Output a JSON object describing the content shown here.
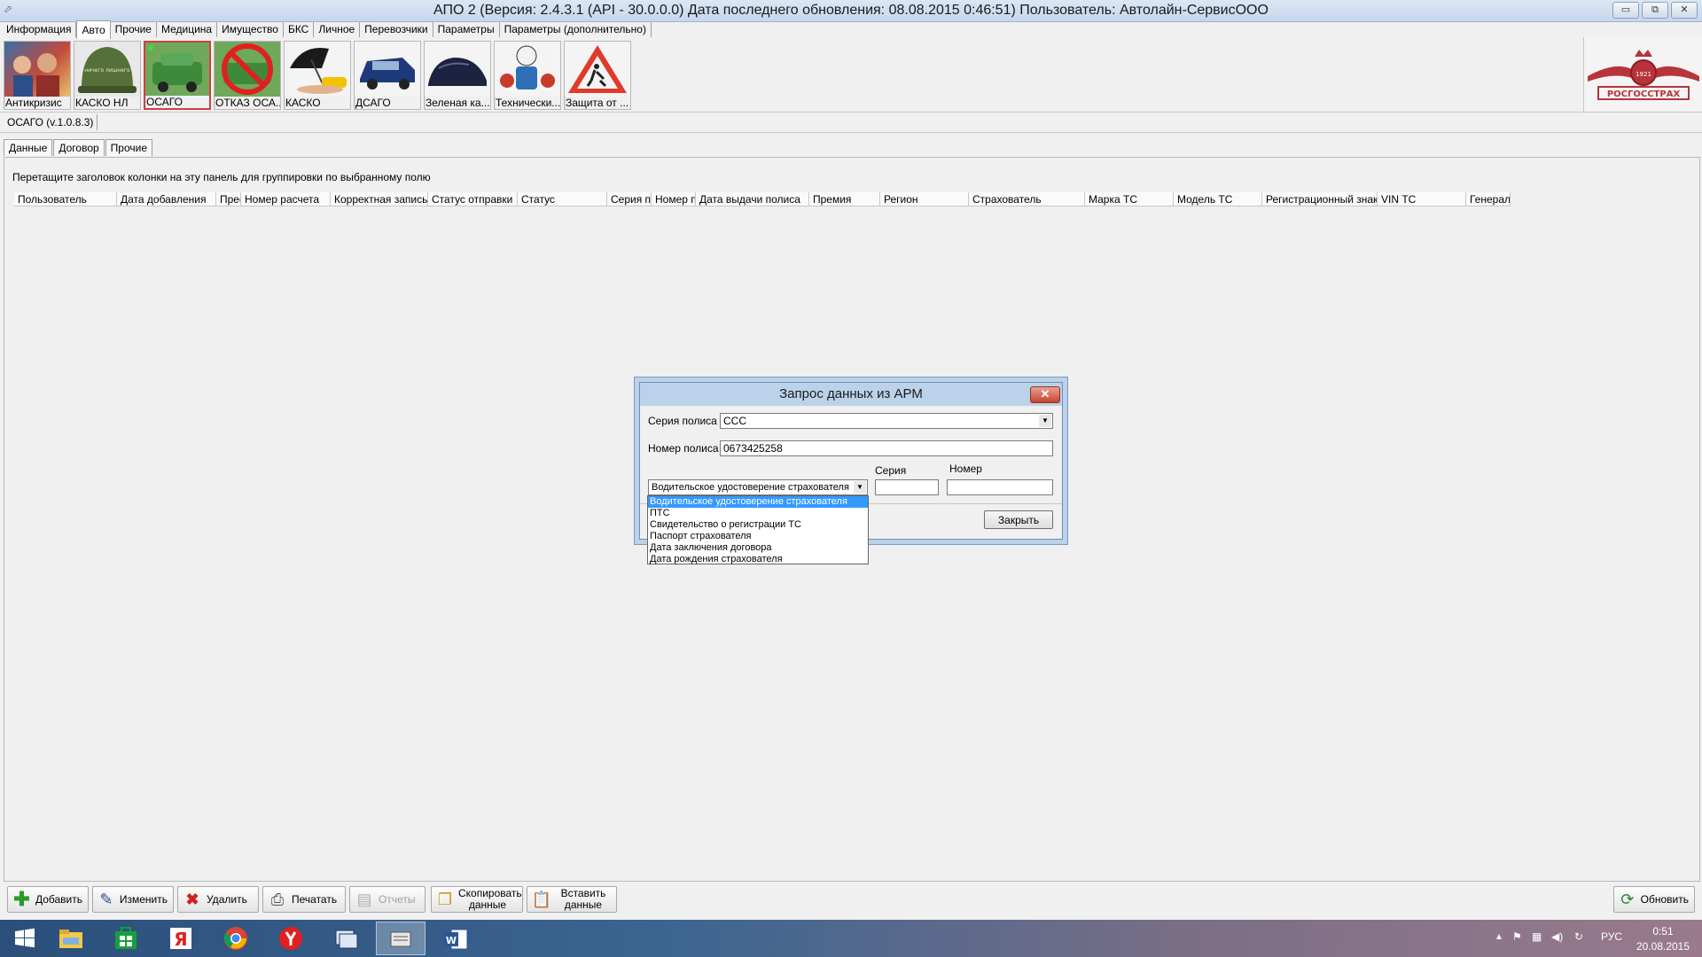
{
  "window": {
    "title": "АПО 2   (Версия: 2.4.3.1 (API - 30.0.0.0)  Дата последнего обновления: 08.08.2015 0:46:51) Пользователь: Автолайн-СервисООО",
    "minimize": "▭",
    "maximize": "⧉",
    "close": "✕"
  },
  "main_tabs": [
    "Информация",
    "Авто",
    "Прочие",
    "Медицина",
    "Имущество",
    "БКС",
    "Личное",
    "Перевозчики",
    "Параметры",
    "Параметры (дополнительно)"
  ],
  "main_tabs_active": 1,
  "products": [
    {
      "label": "Антикризис",
      "icon": "people-icon"
    },
    {
      "label": "КАСКО НЛ",
      "icon": "helmet-icon",
      "caption": "ничего лишнего"
    },
    {
      "label": "ОСАГО",
      "icon": "car-green-icon"
    },
    {
      "label": "ОТКАЗ ОСА...",
      "icon": "car-crossed-icon"
    },
    {
      "label": "КАСКО",
      "icon": "umbrella-car-icon"
    },
    {
      "label": "ДСАГО",
      "icon": "suv-icon"
    },
    {
      "label": "Зеленая ка...",
      "icon": "car-cover-icon"
    },
    {
      "label": "Технически...",
      "icon": "mechanic-icon"
    },
    {
      "label": "Защита от ...",
      "icon": "warning-sign-icon"
    }
  ],
  "products_selected": 2,
  "logo": {
    "text": "РОСГОССТРАХ",
    "year": "1921"
  },
  "module_tab": "ОСАГО (v.1.0.8.3)",
  "sub_tabs": [
    "Данные",
    "Договор",
    "Прочие"
  ],
  "grid": {
    "group_hint": "Перетащите заголовок колонки на эту панель для группировки по выбранному полю",
    "columns": [
      "Пользователь",
      "Дата добавления",
      "Прес",
      "Номер расчета",
      "Корректная запись",
      "Статус отправки",
      "Статус",
      "Серия пс",
      "Номер п",
      "Дата выдачи полиса",
      "Премия",
      "Регион",
      "Страхователь",
      "Марка ТС",
      "Модель ТС",
      "Регистрационный знак",
      "VIN ТС",
      "Генерал"
    ]
  },
  "toolbar": {
    "add": "Добавить",
    "edit": "Изменить",
    "delete": "Удалить",
    "print": "Печатать",
    "reports": "Отчеты",
    "copy": "Скопировать данные",
    "paste": "Вставить данные",
    "refresh": "Обновить"
  },
  "dialog": {
    "title": "Запрос данных из АРМ",
    "close_x": "✕",
    "series_label": "Серия полиса",
    "series_value": "ССС",
    "number_label": "Номер полиса",
    "number_value": "0673425258",
    "doc_series_label": "Серия",
    "doc_number_label": "Номер",
    "doc_type_value": "Водительское удостоверение страхователя",
    "doc_series_value": "",
    "doc_number_value": "",
    "close_button": "Закрыть",
    "doc_options": [
      "Водительское удостоверение страхователя",
      "ПТС",
      "Свидетельство о регистрации ТС",
      "Паспорт страхователя",
      "Дата заключения договора",
      "Дата рождения страхователя"
    ],
    "doc_selected": 0
  },
  "taskbar": {
    "apps": [
      "start-icon",
      "explorer-icon",
      "store-icon",
      "yandex-icon",
      "chrome-icon",
      "yandex-browser-icon",
      "app-icon",
      "apo-icon",
      "word-icon"
    ],
    "active": 7,
    "lang": "РУС",
    "time": "0:51",
    "date": "20.08.2015"
  }
}
